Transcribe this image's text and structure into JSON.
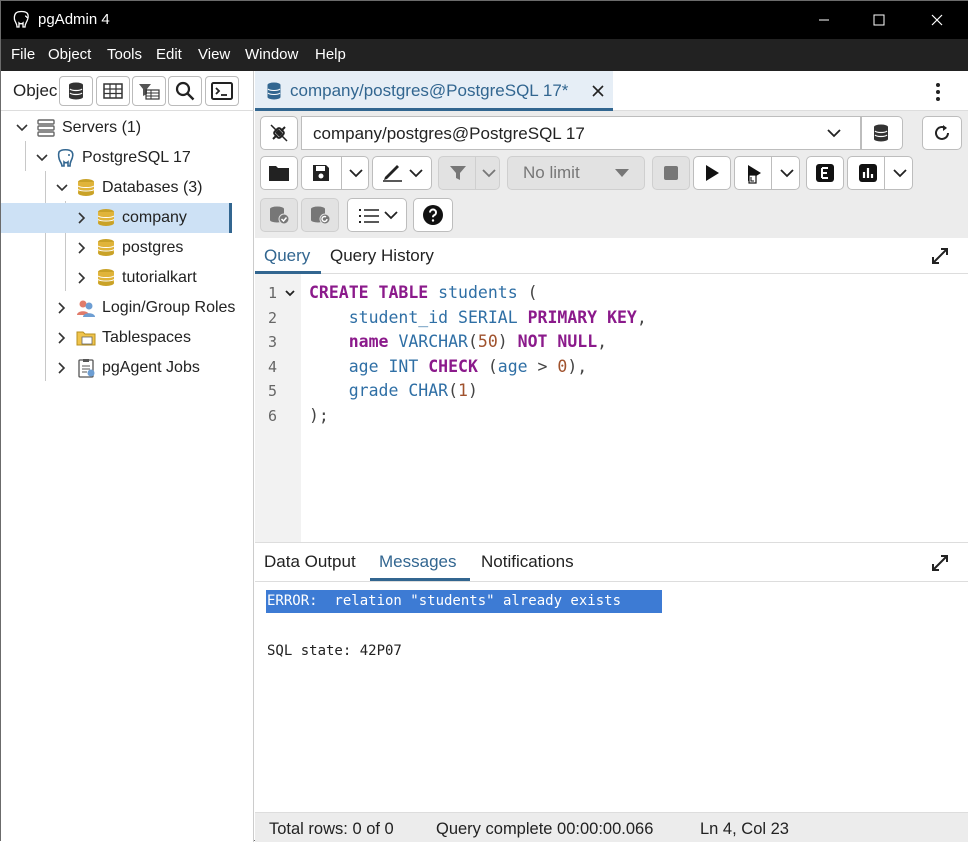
{
  "window": {
    "title": "pgAdmin 4"
  },
  "menu": [
    "File",
    "Object",
    "Tools",
    "Edit",
    "View",
    "Window",
    "Help"
  ],
  "left_panel": {
    "header_label": "Objec",
    "tree": [
      {
        "label": "Servers (1)",
        "icon": "servers-icon"
      },
      {
        "label": "PostgreSQL 17",
        "icon": "postgresql-elephant-icon"
      },
      {
        "label": "Databases (3)",
        "icon": "databases-icon"
      },
      {
        "label": "company",
        "icon": "database-icon",
        "selected": true
      },
      {
        "label": "postgres",
        "icon": "database-icon"
      },
      {
        "label": "tutorialkart",
        "icon": "database-icon"
      },
      {
        "label": "Login/Group Roles",
        "icon": "roles-icon"
      },
      {
        "label": "Tablespaces",
        "icon": "tablespaces-icon"
      },
      {
        "label": "pgAgent Jobs",
        "icon": "pgagent-jobs-icon"
      }
    ]
  },
  "query_tab": {
    "label": "company/postgres@PostgreSQL 17*"
  },
  "toolbar": {
    "connection": "company/postgres@PostgreSQL 17",
    "limit": "No limit"
  },
  "editor_tabs": {
    "query": "Query",
    "history": "Query History"
  },
  "editor": {
    "line_numbers": [
      "1",
      "2",
      "3",
      "4",
      "5",
      "6"
    ]
  },
  "output_tabs": {
    "data_output": "Data Output",
    "messages": "Messages",
    "notifications": "Notifications"
  },
  "messages": {
    "error": "ERROR:  relation \"students\" already exists",
    "sql_state": "SQL state: 42P07"
  },
  "status": {
    "rows": "Total rows: 0 of 0",
    "query": "Query complete 00:00:00.066",
    "cursor": "Ln 4, Col 23"
  },
  "colors": {
    "accent": "#326690",
    "selection": "#cde1f5",
    "error_bg": "#3d7bd4"
  }
}
